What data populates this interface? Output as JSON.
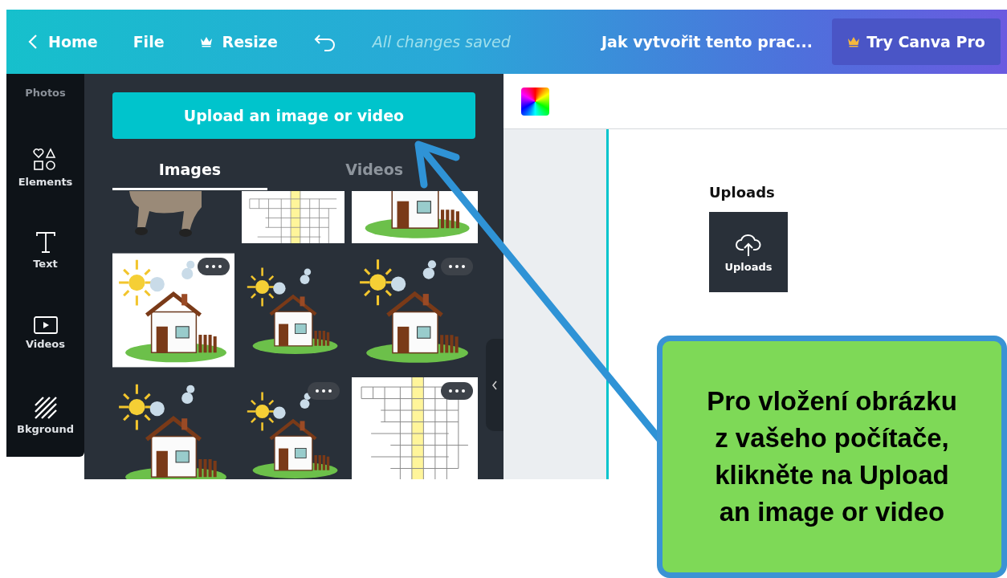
{
  "topbar": {
    "home": "Home",
    "file": "File",
    "resize": "Resize",
    "status": "All changes saved",
    "title": "Jak vytvořit tento prac...",
    "pro_button": "Try Canva Pro"
  },
  "sidebar": {
    "items": [
      {
        "kind": "photos",
        "label": "Photos"
      },
      {
        "kind": "elements",
        "label": "Elements"
      },
      {
        "kind": "text",
        "label": "Text"
      },
      {
        "kind": "videos",
        "label": "Videos"
      },
      {
        "kind": "background",
        "label": "Bkground"
      }
    ]
  },
  "panel": {
    "upload_button": "Upload an image or video",
    "tabs": [
      {
        "label": "Images",
        "selected": true
      },
      {
        "label": "Videos",
        "selected": false
      }
    ],
    "thumbnails": [
      {
        "kind": "animal",
        "menu": false
      },
      {
        "kind": "crossword",
        "menu": false
      },
      {
        "kind": "house_cut",
        "menu": false
      },
      {
        "kind": "house_white",
        "menu": true
      },
      {
        "kind": "house",
        "menu": false
      },
      {
        "kind": "house",
        "menu": true
      },
      {
        "kind": "house",
        "menu": false
      },
      {
        "kind": "house",
        "menu": true
      },
      {
        "kind": "crossword",
        "menu": true
      }
    ]
  },
  "canvas": {
    "heading": "Uploads",
    "tile_label": "Uploads"
  },
  "callout": {
    "lines": [
      "Pro vložení obrázku",
      "z vašeho počítače,",
      "klikněte na Upload",
      "an image or video"
    ]
  }
}
